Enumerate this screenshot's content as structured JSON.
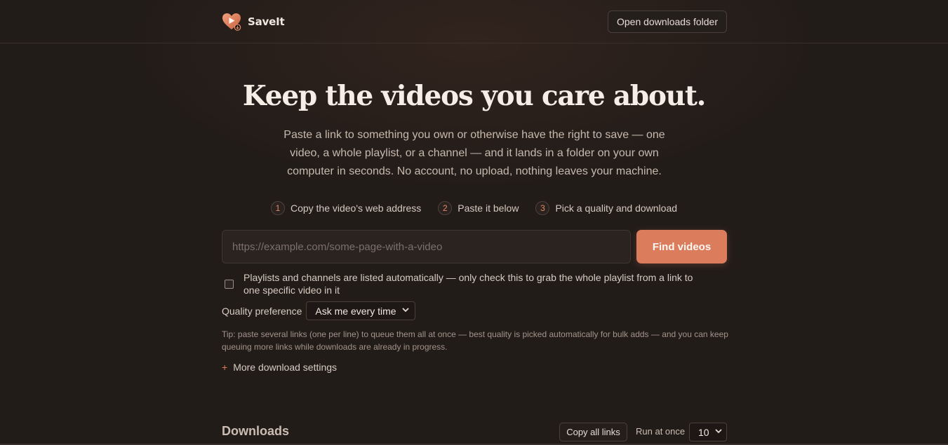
{
  "header": {
    "app_name": "SaveIt",
    "open_folder_label": "Open downloads folder"
  },
  "hero": {
    "title": "Keep the videos you care about.",
    "subtitle": "Paste a link to something you own or otherwise have the right to save — one video, a whole playlist, or a channel — and it lands in a folder on your own computer in seconds. No account, no upload, nothing leaves your machine."
  },
  "steps": [
    {
      "num": "1",
      "label": "Copy the video's web address"
    },
    {
      "num": "2",
      "label": "Paste it below"
    },
    {
      "num": "3",
      "label": "Pick a quality and download"
    }
  ],
  "search": {
    "placeholder": "https://example.com/some-page-with-a-video",
    "value": "",
    "button_label": "Find videos"
  },
  "options": {
    "playlist_checkbox_label": "Playlists and channels are listed automatically — only check this to grab the whole playlist from a link to one specific video in it",
    "playlist_checked": false,
    "quality_label": "Quality preference",
    "quality_value": "Ask me every time",
    "tip": "Tip: paste several links (one per line) to queue them all at once — best quality is picked automatically for bulk adds — and you can keep queuing more links while downloads are already in progress.",
    "more_settings_label": "More download settings"
  },
  "downloads": {
    "title": "Downloads",
    "copy_links_label": "Copy all links",
    "run_at_once_label": "Run at once",
    "run_at_once_value": "10"
  },
  "colors": {
    "background": "#221c19",
    "accent": "#db7c5c",
    "text": "#e9ded6"
  }
}
